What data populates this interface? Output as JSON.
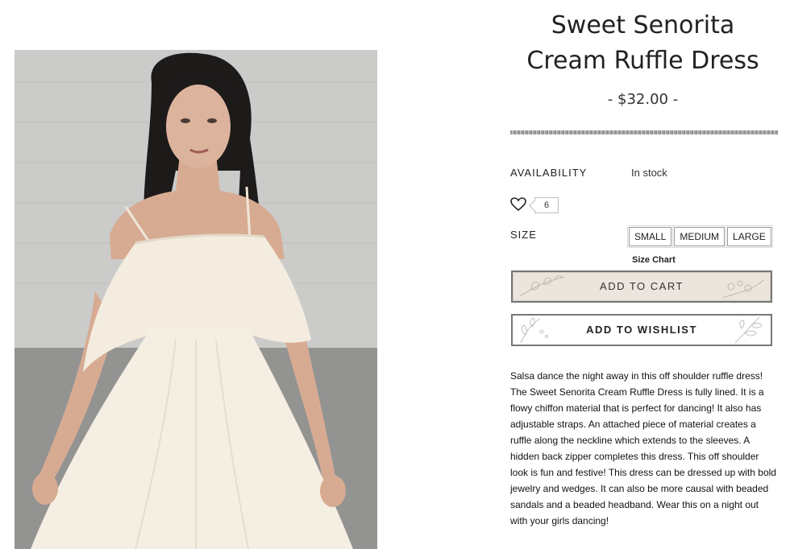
{
  "product": {
    "title_line1": "Sweet Senorita",
    "title_line2": "Cream Ruffle Dress",
    "price": "- $32.00 -",
    "availability_label": "AVAILABILITY",
    "availability_value": "In stock",
    "likes": "6",
    "size_label": "SIZE",
    "sizes": [
      "SMALL",
      "MEDIUM",
      "LARGE"
    ],
    "size_chart_label": "Size Chart",
    "add_to_cart_label": "ADD TO CART",
    "add_to_wishlist_label": "ADD TO WISHLIST",
    "description": "Salsa dance the night away in this off shoulder ruffle dress! The Sweet Senorita Cream Ruffle Dress is fully lined. It is a flowy chiffon material that is perfect for dancing! It also has adjustable straps. An attached piece of material creates a ruffle along the neckline which extends to the sleeves. A hidden back zipper completes this dress. This off shoulder look is fun and festive! This dress can be dressed up with bold jewelry and wedges. It can also be more causal with beaded sandals and a beaded headband. Wear this on a night out with your girls dancing!"
  },
  "icons": {
    "like": "heart-icon",
    "cart_decoration": "floral-doodle-icon",
    "wishlist_decoration": "leaf-doodle-icon"
  },
  "colors": {
    "cart_background": "#ece5dd",
    "dress": "#f3ecdf",
    "text": "#222222"
  }
}
